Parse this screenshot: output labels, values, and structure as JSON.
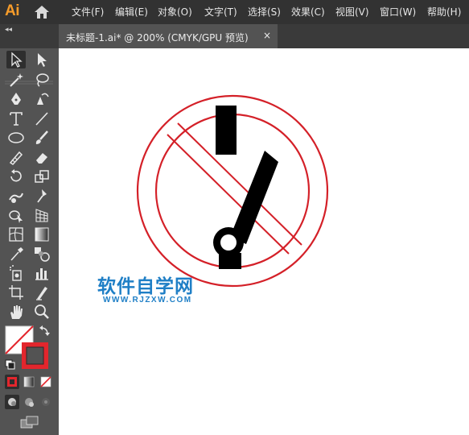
{
  "app": {
    "logo": "Ai"
  },
  "menu": [
    {
      "label": "文件(F)"
    },
    {
      "label": "编辑(E)"
    },
    {
      "label": "对象(O)"
    },
    {
      "label": "文字(T)"
    },
    {
      "label": "选择(S)"
    },
    {
      "label": "效果(C)"
    },
    {
      "label": "视图(V)"
    },
    {
      "label": "窗口(W)"
    },
    {
      "label": "帮助(H)"
    }
  ],
  "toolbar_collapse": "◂◂",
  "tab": {
    "title": "未标题-1.ai* @ 200% (CMYK/GPU 预览)",
    "close": "×"
  },
  "tools": [
    {
      "name": "selection-tool-icon",
      "active": true
    },
    {
      "name": "direct-selection-tool-icon"
    },
    {
      "name": "magic-wand-tool-icon"
    },
    {
      "name": "lasso-tool-icon"
    },
    {
      "name": "pen-tool-icon"
    },
    {
      "name": "curvature-tool-icon"
    },
    {
      "name": "type-tool-icon"
    },
    {
      "name": "line-segment-tool-icon"
    },
    {
      "name": "ellipse-tool-icon"
    },
    {
      "name": "paintbrush-tool-icon"
    },
    {
      "name": "shaper-tool-icon"
    },
    {
      "name": "eraser-tool-icon"
    },
    {
      "name": "rotate-tool-icon"
    },
    {
      "name": "scale-tool-icon"
    },
    {
      "name": "warp-tool-icon"
    },
    {
      "name": "puppet-warp-tool-icon"
    },
    {
      "name": "shape-builder-tool-icon"
    },
    {
      "name": "perspective-grid-tool-icon"
    },
    {
      "name": "mesh-tool-icon"
    },
    {
      "name": "gradient-tool-icon"
    },
    {
      "name": "eyedropper-tool-icon"
    },
    {
      "name": "blend-tool-icon"
    },
    {
      "name": "symbol-sprayer-tool-icon"
    },
    {
      "name": "column-graph-tool-icon"
    },
    {
      "name": "artboard-tool-icon"
    },
    {
      "name": "slice-tool-icon"
    },
    {
      "name": "hand-tool-icon"
    },
    {
      "name": "zoom-tool-icon"
    }
  ],
  "colors": {
    "fill": "none",
    "stroke": "#e3262d",
    "menubar_bg": "#323232",
    "panel_bg": "#535353",
    "canvas_bg": "#ffffff",
    "logo": "#f79c2a",
    "artwork_red": "#d42028",
    "artwork_black": "#000000",
    "watermark": "#1f7fc6"
  },
  "watermark": {
    "title": "软件自学网",
    "url": "WWW.RJZXW.COM"
  }
}
